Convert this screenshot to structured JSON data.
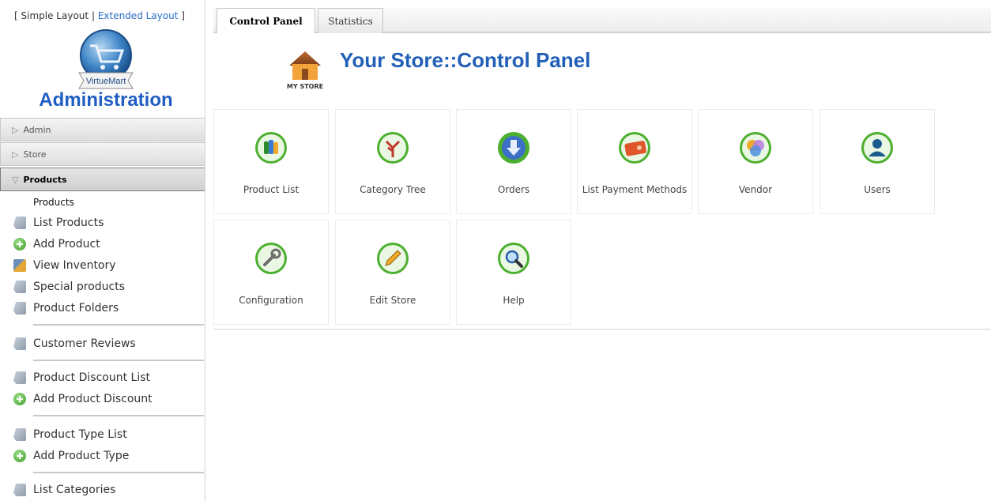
{
  "sidebar": {
    "layout_switch": {
      "open": "[",
      "simple": "Simple Layout",
      "sep": "|",
      "extended": "Extended Layout",
      "close": "]"
    },
    "logo_text": "VirtueMart",
    "title": "Administration",
    "sections": [
      {
        "label": "Admin",
        "state": "collapsed"
      },
      {
        "label": "Store",
        "state": "collapsed"
      },
      {
        "label": "Products",
        "state": "expanded"
      }
    ],
    "products_heading": "Products",
    "items": [
      {
        "label": "List Products",
        "icon": "document-icon"
      },
      {
        "label": "Add Product",
        "icon": "add-icon"
      },
      {
        "label": "View Inventory",
        "icon": "inventory-icon"
      },
      {
        "label": "Special products",
        "icon": "document-icon"
      },
      {
        "label": "Product Folders",
        "icon": "document-icon"
      },
      {
        "label": "Customer Reviews",
        "icon": "document-icon"
      },
      {
        "label": "Product Discount List",
        "icon": "document-icon"
      },
      {
        "label": "Add Product Discount",
        "icon": "add-icon"
      },
      {
        "label": "Product Type List",
        "icon": "document-icon"
      },
      {
        "label": "Add Product Type",
        "icon": "add-icon"
      },
      {
        "label": "List Categories",
        "icon": "document-icon"
      }
    ]
  },
  "tabs": [
    {
      "label": "Control Panel",
      "active": true
    },
    {
      "label": "Statistics",
      "active": false
    }
  ],
  "main": {
    "logo_caption": "MY STORE",
    "title": "Your Store::Control Panel",
    "tiles": [
      {
        "label": "Product List",
        "icon": "product-list-icon"
      },
      {
        "label": "Category Tree",
        "icon": "category-tree-icon"
      },
      {
        "label": "Orders",
        "icon": "orders-icon"
      },
      {
        "label": "List Payment Methods",
        "icon": "payment-methods-icon"
      },
      {
        "label": "Vendor",
        "icon": "vendor-icon"
      },
      {
        "label": "Users",
        "icon": "users-icon"
      },
      {
        "label": "Configuration",
        "icon": "configuration-icon"
      },
      {
        "label": "Edit Store",
        "icon": "edit-store-icon"
      },
      {
        "label": "Help",
        "icon": "help-icon"
      }
    ]
  },
  "colors": {
    "accent": "#1f5ec2",
    "title_blue": "#2260b8",
    "icon_green": "#4caf2f"
  }
}
